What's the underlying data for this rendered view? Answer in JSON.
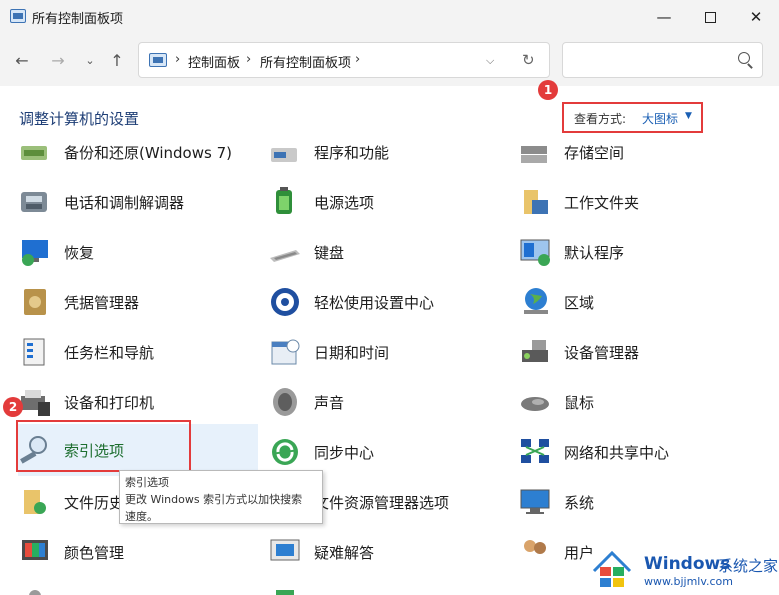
{
  "window": {
    "title": "所有控制面板项"
  },
  "addressbar": {
    "crumb1": "控制面板",
    "crumb2": "所有控制面板项"
  },
  "content": {
    "heading": "调整计算机的设置"
  },
  "view": {
    "label": "查看方式:",
    "value": "大图标"
  },
  "badges": {
    "one": "1",
    "two": "2"
  },
  "items": {
    "r0c0": "备份和还原(Windows 7)",
    "r0c1": "程序和功能",
    "r0c2": "存储空间",
    "r1c0": "电话和调制解调器",
    "r1c1": "电源选项",
    "r1c2": "工作文件夹",
    "r2c0": "恢复",
    "r2c1": "键盘",
    "r2c2": "默认程序",
    "r3c0": "凭据管理器",
    "r3c1": "轻松使用设置中心",
    "r3c2": "区域",
    "r4c0": "任务栏和导航",
    "r4c1": "日期和时间",
    "r4c2": "设备管理器",
    "r5c0": "设备和打印机",
    "r5c1": "声音",
    "r5c2": "鼠标",
    "r6c0": "索引选项",
    "r6c1": "同步中心",
    "r6c2": "网络和共享中心",
    "r7c0": "文件历史",
    "r7c1": "文件资源管理器选项",
    "r7c2": "系统",
    "r8c0": "颜色管理",
    "r8c1": "疑难解答",
    "r8c2": "用户"
  },
  "tooltip": {
    "title": "索引选项",
    "line1": "更改 Windows 索引方式以加快搜索",
    "line2": "速度。"
  },
  "watermark": {
    "brand": "Windows",
    "suffix": "系统之家",
    "url": "www.bjjmlv.com"
  }
}
